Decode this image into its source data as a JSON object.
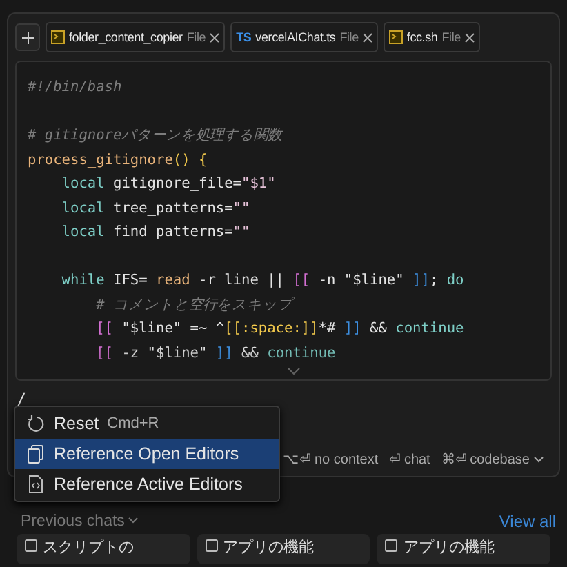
{
  "tabs": [
    {
      "kind": "shell",
      "name": "folder_content_copier",
      "type": "File"
    },
    {
      "kind": "ts",
      "badge": "TS",
      "name": "vercelAIChat.ts",
      "type": "File"
    },
    {
      "kind": "shell",
      "name": "fcc.sh",
      "type": "File"
    }
  ],
  "code": [
    {
      "kind": "text",
      "tokens": [
        {
          "kind": "comment",
          "t": "#!/bin/bash"
        }
      ]
    },
    {
      "kind": "blank"
    },
    {
      "kind": "text",
      "tokens": [
        {
          "kind": "comment",
          "t": "# gitignoreパターンを処理する関数"
        }
      ]
    },
    {
      "kind": "text",
      "tokens": [
        {
          "kind": "fn",
          "t": "process_gitignore"
        },
        {
          "kind": "paren",
          "t": "() {"
        }
      ]
    },
    {
      "kind": "text",
      "tokens": [
        {
          "kind": "kw",
          "t": "    local"
        },
        {
          "kind": "plain",
          "t": " gitignore_file="
        },
        {
          "kind": "str",
          "t": "\"$1\""
        }
      ]
    },
    {
      "kind": "text",
      "tokens": [
        {
          "kind": "kw",
          "t": "    local"
        },
        {
          "kind": "plain",
          "t": " tree_patterns="
        },
        {
          "kind": "str",
          "t": "\"\""
        }
      ]
    },
    {
      "kind": "text",
      "tokens": [
        {
          "kind": "kw",
          "t": "    local"
        },
        {
          "kind": "plain",
          "t": " find_patterns="
        },
        {
          "kind": "str",
          "t": "\"\""
        }
      ]
    },
    {
      "kind": "blank"
    },
    {
      "kind": "text",
      "tokens": [
        {
          "kind": "kw",
          "t": "    while"
        },
        {
          "kind": "plain",
          "t": " IFS= "
        },
        {
          "kind": "fn",
          "t": "read"
        },
        {
          "kind": "plain",
          "t": " -r line || "
        },
        {
          "kind": "bracket",
          "t": "[["
        },
        {
          "kind": "plain",
          "t": " -n \"$line\" "
        },
        {
          "kind": "bracket2",
          "t": "]]"
        },
        {
          "kind": "plain",
          "t": "; "
        },
        {
          "kind": "kw",
          "t": "do"
        }
      ]
    },
    {
      "kind": "text",
      "tokens": [
        {
          "kind": "comment",
          "t": "        # コメントと空行をスキップ"
        }
      ]
    },
    {
      "kind": "text",
      "tokens": [
        {
          "kind": "bracket",
          "t": "        [["
        },
        {
          "kind": "plain",
          "t": " \"$line\" =~ ^"
        },
        {
          "kind": "paren",
          "t": "[[:space:]]"
        },
        {
          "kind": "plain",
          "t": "*# "
        },
        {
          "kind": "bracket2",
          "t": "]]"
        },
        {
          "kind": "plain",
          "t": " && "
        },
        {
          "kind": "kw",
          "t": "continue"
        }
      ]
    },
    {
      "kind": "text",
      "tokens": [
        {
          "kind": "bracket",
          "t": "        [["
        },
        {
          "kind": "plain",
          "t": " -z \"$line\" "
        },
        {
          "kind": "bracket2",
          "t": "]]"
        },
        {
          "kind": "plain",
          "t": " && "
        },
        {
          "kind": "kw",
          "t": "continue"
        }
      ]
    }
  ],
  "input": {
    "value": "/"
  },
  "menu": [
    {
      "kind": "reset",
      "label": "Reset",
      "shortcut": "Cmd+R",
      "selected": false
    },
    {
      "kind": "open",
      "label": "Reference Open Editors",
      "selected": true
    },
    {
      "kind": "active",
      "label": "Reference Active Editors",
      "selected": false
    }
  ],
  "modes": [
    {
      "keys": "⌥⏎",
      "label": "no context",
      "dropdown": false
    },
    {
      "keys": "⏎",
      "label": "chat",
      "dropdown": false
    },
    {
      "keys": "⌘⏎",
      "label": "codebase",
      "dropdown": true
    }
  ],
  "previous": {
    "label": "Previous chats",
    "link": "View all"
  },
  "chats": [
    {
      "title": "スクリプトの"
    },
    {
      "title": "アプリの機能"
    },
    {
      "title": "アプリの機能"
    }
  ]
}
